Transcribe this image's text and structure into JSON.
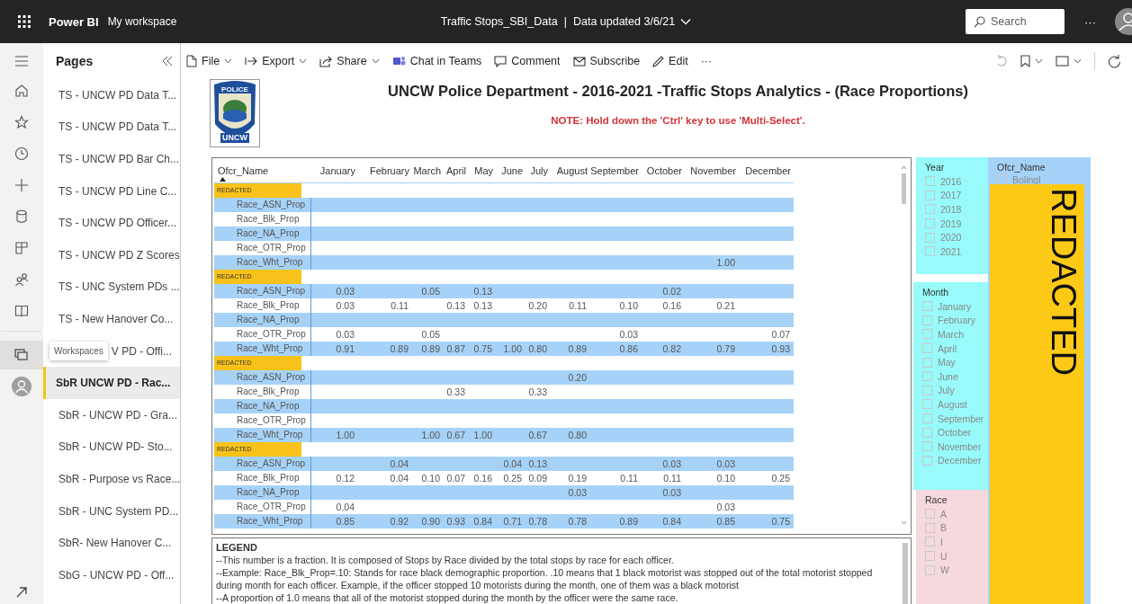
{
  "app_bar": {
    "product": "Power BI",
    "workspace": "My workspace",
    "report_name": "Traffic Stops_SBI_Data",
    "separator": "|",
    "data_updated": "Data updated 3/6/21",
    "search_placeholder": "Search",
    "more": "···"
  },
  "toolbar": {
    "items": [
      {
        "kind": "file",
        "label": "File",
        "dropdown": true
      },
      {
        "kind": "export",
        "label": "Export",
        "dropdown": true
      },
      {
        "kind": "share",
        "label": "Share",
        "dropdown": true
      },
      {
        "kind": "teams",
        "label": "Chat in Teams",
        "dropdown": false
      },
      {
        "kind": "comment",
        "label": "Comment",
        "dropdown": false
      },
      {
        "kind": "subscribe",
        "label": "Subscribe",
        "dropdown": false
      },
      {
        "kind": "edit",
        "label": "Edit",
        "dropdown": false
      }
    ],
    "more": "···"
  },
  "pages_panel": {
    "title": "Pages",
    "items": [
      {
        "label": "TS - UNCW PD Data T...",
        "selected": false
      },
      {
        "label": "TS - UNCW PD Data T...",
        "selected": false
      },
      {
        "label": "TS - UNCW PD Bar Ch...",
        "selected": false
      },
      {
        "label": "TS - UNCW PD Line C...",
        "selected": false
      },
      {
        "label": "TS - UNCW PD Officer...",
        "selected": false
      },
      {
        "label": "TS - UNCW PD Z Scores",
        "selected": false
      },
      {
        "label": "TS - UNC System PDs ...",
        "selected": false
      },
      {
        "label": "TS - New Hanover Co...",
        "selected": false
      },
      {
        "label": "V PD - Offi...",
        "selected": false,
        "tooltip": "Workspaces"
      },
      {
        "label": "SbR UNCW PD - Rac...",
        "selected": true
      },
      {
        "label": "SbR - UNCW PD - Gra...",
        "selected": false
      },
      {
        "label": "SbR - UNCW PD- Sto...",
        "selected": false
      },
      {
        "label": "SbR - Purpose vs Race...",
        "selected": false
      },
      {
        "label": "SbR - UNC System PD...",
        "selected": false
      },
      {
        "label": "SbR- New Hanover C...",
        "selected": false
      },
      {
        "label": "SbG - UNCW PD - Off...",
        "selected": false
      }
    ]
  },
  "report": {
    "logo": {
      "top": "POLICE",
      "bottom": "UNCW"
    },
    "title": "UNCW Police Department - 2016-2021 -Traffic Stops Analytics - (Race Proportions)",
    "note": "NOTE: Hold down the 'Ctrl' key to use 'Multi-Select'.",
    "table": {
      "columns": [
        "Ofcr_Name",
        "January",
        "February",
        "March",
        "April",
        "May",
        "June",
        "July",
        "August",
        "September",
        "October",
        "November",
        "December"
      ],
      "groups": [
        {
          "officer": "REDACTED",
          "rows": [
            {
              "label": "Race_ASN_Prop"
            },
            {
              "label": "Race_Blk_Prop"
            },
            {
              "label": "Race_NA_Prop"
            },
            {
              "label": "Race_OTR_Prop"
            },
            {
              "label": "Race_Wht_Prop",
              "values": {
                "nov": "1.00"
              }
            }
          ]
        },
        {
          "officer": "REDACTED",
          "rows": [
            {
              "label": "Race_ASN_Prop",
              "values": {
                "jan": "0.03",
                "mar": "0.05",
                "may": "0.13",
                "oct": "0.02"
              }
            },
            {
              "label": "Race_Blk_Prop",
              "values": {
                "jan": "0.03",
                "feb": "0.11",
                "apr": "0.13",
                "may": "0.13",
                "jul": "0.20",
                "aug": "0.11",
                "sep": "0.10",
                "oct": "0.16",
                "nov": "0.21"
              }
            },
            {
              "label": "Race_NA_Prop"
            },
            {
              "label": "Race_OTR_Prop",
              "values": {
                "jan": "0.03",
                "mar": "0.05",
                "sep": "0.03",
                "dec": "0.07"
              }
            },
            {
              "label": "Race_Wht_Prop",
              "values": {
                "jan": "0.91",
                "feb": "0.89",
                "mar": "0.89",
                "apr": "0.87",
                "may": "0.75",
                "jun": "1.00",
                "jul": "0.80",
                "aug": "0.89",
                "sep": "0.86",
                "oct": "0.82",
                "nov": "0.79",
                "dec": "0.93"
              }
            }
          ]
        },
        {
          "officer": "REDACTED",
          "rows": [
            {
              "label": "Race_ASN_Prop",
              "values": {
                "aug": "0.20"
              }
            },
            {
              "label": "Race_Blk_Prop",
              "values": {
                "apr": "0.33",
                "jul": "0.33"
              }
            },
            {
              "label": "Race_NA_Prop"
            },
            {
              "label": "Race_OTR_Prop"
            },
            {
              "label": "Race_Wht_Prop",
              "values": {
                "jan": "1.00",
                "mar": "1.00",
                "apr": "0.67",
                "may": "1.00",
                "jul": "0.67",
                "aug": "0.80"
              }
            }
          ]
        },
        {
          "officer": "REDACTED",
          "rows": [
            {
              "label": "Race_ASN_Prop",
              "values": {
                "feb": "0.04",
                "jun": "0.04",
                "jul": "0.13",
                "oct": "0.03",
                "nov": "0.03"
              }
            },
            {
              "label": "Race_Blk_Prop",
              "values": {
                "jan": "0.12",
                "feb": "0.04",
                "mar": "0.10",
                "apr": "0.07",
                "may": "0.16",
                "jun": "0.25",
                "jul": "0.09",
                "aug": "0.19",
                "sep": "0.11",
                "oct": "0.11",
                "nov": "0.10",
                "dec": "0.25"
              }
            },
            {
              "label": "Race_NA_Prop",
              "values": {
                "aug": "0.03",
                "oct": "0.03"
              }
            },
            {
              "label": "Race_OTR_Prop",
              "values": {
                "jan": "0.04",
                "nov": "0.03"
              }
            },
            {
              "label": "Race_Wht_Prop",
              "values": {
                "jan": "0.85",
                "feb": "0.92",
                "mar": "0.90",
                "apr": "0.93",
                "may": "0.84",
                "jun": "0.71",
                "jul": "0.78",
                "aug": "0.78",
                "sep": "0.89",
                "oct": "0.84",
                "nov": "0.85",
                "dec": "0.75"
              }
            }
          ]
        }
      ]
    },
    "legend": {
      "title": "LEGEND",
      "lines": [
        "--This number is a fraction.  It is composed of Stops by Race divided by the total stops by race for each officer.",
        "--Example: Race_Blk_Prop=.10: Stands for race black demographic proportion.  .10 means that 1 black motorist was stopped out of the total motorist stopped during month for each officer.  Example, if the officer stopped 10 motorists during the month, one of them was a black motorist",
        "--A proportion of 1.0 means that all of the motorist stopped during the month by the officer were the same race."
      ]
    },
    "slicers": [
      {
        "title": "Year",
        "color": "#98fafa",
        "items": [
          {
            "label": "2016",
            "checked": false
          },
          {
            "label": "2017",
            "checked": false
          },
          {
            "label": "2018",
            "checked": false
          },
          {
            "label": "2019",
            "checked": false
          },
          {
            "label": "2020",
            "checked": false
          },
          {
            "label": "2021",
            "checked": false
          }
        ]
      },
      {
        "title": "Month",
        "color": "#98fafa",
        "items": [
          {
            "label": "January",
            "checked": false
          },
          {
            "label": "February",
            "checked": false
          },
          {
            "label": "March",
            "checked": false
          },
          {
            "label": "April",
            "checked": false
          },
          {
            "label": "May",
            "checked": false
          },
          {
            "label": "June",
            "checked": false
          },
          {
            "label": "July",
            "checked": false
          },
          {
            "label": "August",
            "checked": false
          },
          {
            "label": "September",
            "checked": false
          },
          {
            "label": "October",
            "checked": false
          },
          {
            "label": "November",
            "checked": false
          },
          {
            "label": "December",
            "checked": false
          }
        ]
      },
      {
        "title": "Race",
        "color": "#f6d9dc",
        "items": [
          {
            "label": "A",
            "checked": false
          },
          {
            "label": "B",
            "checked": false
          },
          {
            "label": "I",
            "checked": false
          },
          {
            "label": "U",
            "checked": false
          },
          {
            "label": "W",
            "checked": false
          }
        ]
      }
    ],
    "officer_slicer": {
      "title": "Ofcr_Name",
      "color": "#a6d2f8",
      "items": [
        {
          "label": "Bolingl",
          "checked": false
        }
      ],
      "redaction": "REDACTED"
    }
  }
}
